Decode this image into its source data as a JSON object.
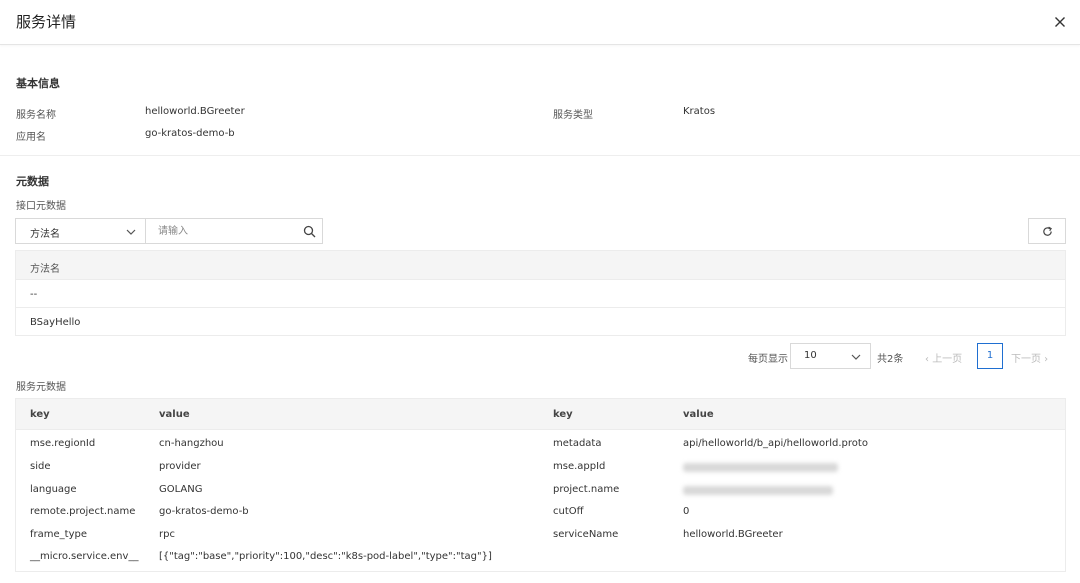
{
  "header": {
    "title": "服务详情",
    "close_icon": "close-icon"
  },
  "basic": {
    "title": "基本信息",
    "service_name_label": "服务名称",
    "service_name_value": "helloworld.BGreeter",
    "service_type_label": "服务类型",
    "service_type_value": "Kratos",
    "app_name_label": "应用名",
    "app_name_value": "go-kratos-demo-b"
  },
  "metadata": {
    "title": "元数据",
    "interface_title": "接口元数据",
    "select_value": "方法名",
    "search_placeholder": "请输入",
    "table_header": "方法名",
    "rows": [
      "--",
      "BSayHello"
    ]
  },
  "pagination": {
    "per_page_label": "每页显示",
    "page_size": "10",
    "total": "共2条",
    "prev": "上一页",
    "current_page": "1",
    "next": "下一页"
  },
  "service_meta": {
    "title": "服务元数据",
    "headers": [
      "key",
      "value",
      "key",
      "value"
    ],
    "left": [
      {
        "key": "mse.regionId",
        "value": "cn-hangzhou"
      },
      {
        "key": "side",
        "value": "provider"
      },
      {
        "key": "language",
        "value": "GOLANG"
      },
      {
        "key": "remote.project.name",
        "value": "go-kratos-demo-b"
      },
      {
        "key": "frame_type",
        "value": "rpc"
      },
      {
        "key": "__micro.service.env__",
        "value": "[{\"tag\":\"base\",\"priority\":100,\"desc\":\"k8s-pod-label\",\"type\":\"tag\"}]"
      }
    ],
    "right": [
      {
        "key": "metadata",
        "value": "api/helloworld/b_api/helloworld.proto"
      },
      {
        "key": "mse.appId",
        "value": ""
      },
      {
        "key": "project.name",
        "value": ""
      },
      {
        "key": "cutOff",
        "value": "0"
      },
      {
        "key": "serviceName",
        "value": "helloworld.BGreeter"
      }
    ]
  },
  "colors": {
    "accent": "#1f6fd1",
    "header_bg": "#f5f5f5",
    "border": "#ececec"
  }
}
